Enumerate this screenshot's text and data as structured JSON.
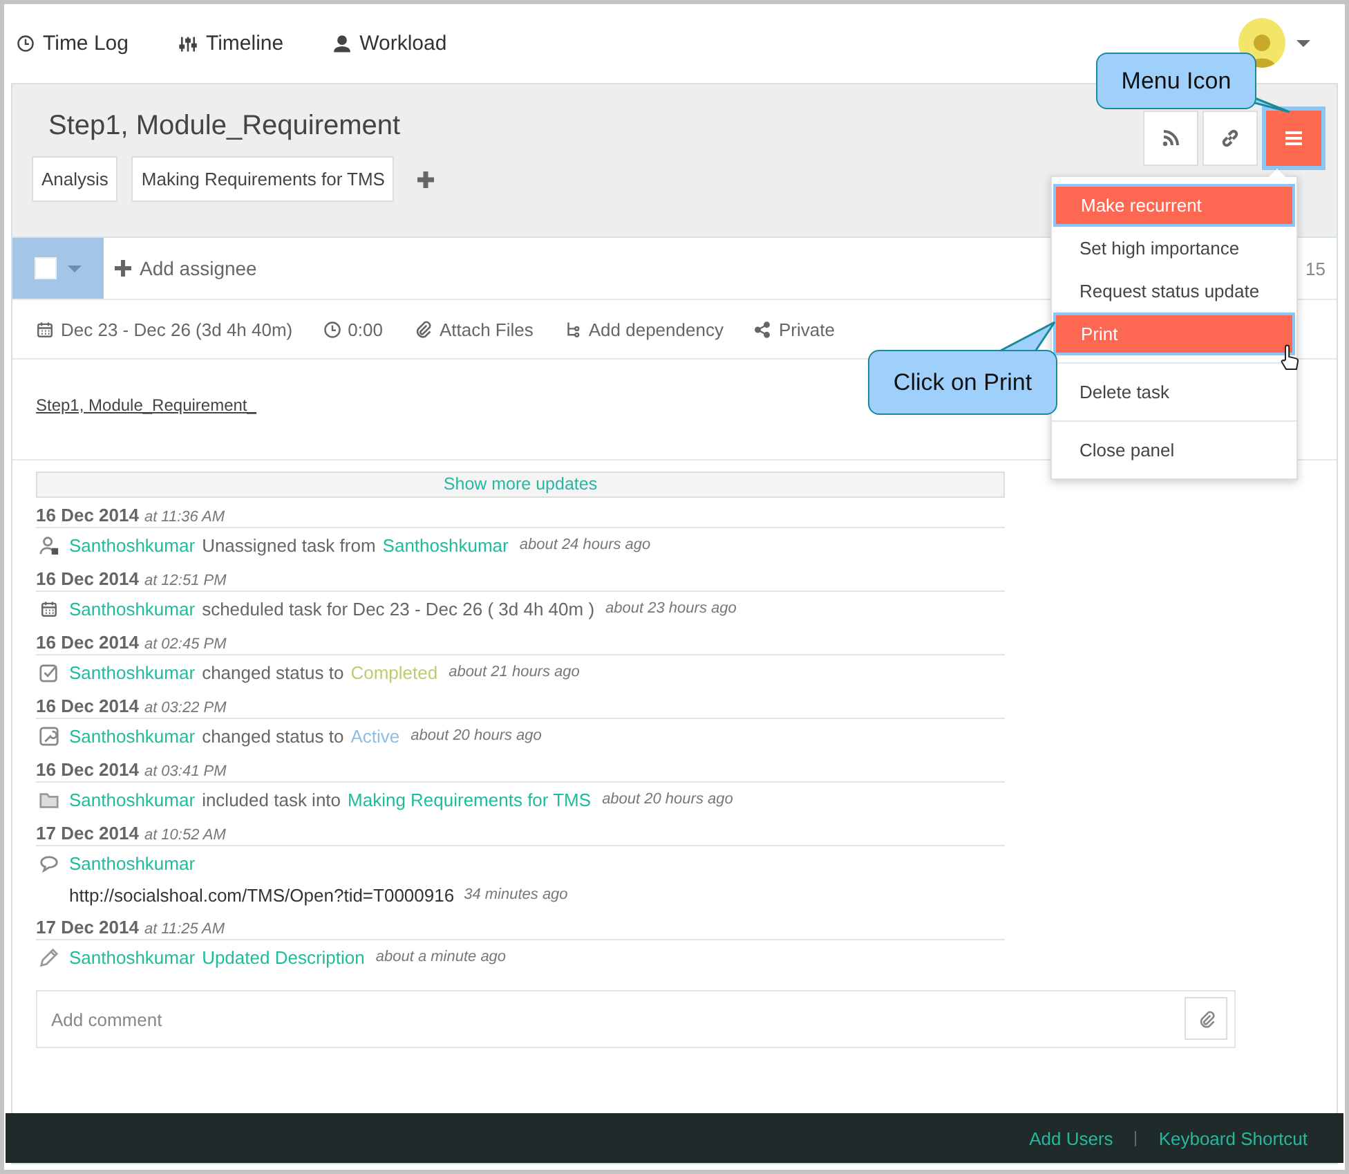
{
  "nav": [
    {
      "label": "Time Log"
    },
    {
      "label": "Timeline"
    },
    {
      "label": "Workload"
    }
  ],
  "task": {
    "title": "Step1, Module_Requirement",
    "tags": [
      "Analysis",
      "Making Requirements for TMS"
    ],
    "select_checkbox": {
      "checked": false
    },
    "add_assignee": "Add assignee",
    "assignee_count": "15",
    "meta": [
      {
        "label": "Dec 23 - Dec 26 (3d 4h 40m)"
      },
      {
        "label": "0:00"
      },
      {
        "label": "Attach Files"
      },
      {
        "label": "Add dependency"
      },
      {
        "label": "Private"
      }
    ],
    "description": "Step1, Module_Requirement_"
  },
  "menu": [
    {
      "label": "Make recurrent",
      "highlighted": true,
      "divider_before": false
    },
    {
      "label": "Set high importance",
      "highlighted": false,
      "divider_before": false
    },
    {
      "label": "Request status update",
      "highlighted": false,
      "divider_before": false
    },
    {
      "label": "Print",
      "highlighted": true,
      "divider_before": false
    },
    {
      "label": "Delete task",
      "highlighted": false,
      "divider_before": true
    },
    {
      "label": "Close panel",
      "highlighted": false,
      "divider_before": true
    }
  ],
  "callouts": [
    {
      "kind": "menu",
      "text": "Menu Icon"
    },
    {
      "kind": "print",
      "text": "Click on Print"
    }
  ],
  "updates": {
    "show_more": "Show more updates",
    "entries": [
      {
        "date": "16 Dec 2014",
        "time": "at 11:36 AM",
        "kind": "unassign",
        "segments": [
          {
            "kind": "user",
            "text": "Santhoshkumar"
          },
          {
            "kind": "text",
            "text": "Unassigned task from"
          },
          {
            "kind": "user",
            "text": "Santhoshkumar"
          }
        ],
        "ago": "about 24 hours ago"
      },
      {
        "date": "16 Dec 2014",
        "time": "at 12:51 PM",
        "kind": "calendar",
        "segments": [
          {
            "kind": "user",
            "text": "Santhoshkumar"
          },
          {
            "kind": "text",
            "text": "scheduled task for Dec 23 - Dec 26 ( 3d 4h 40m )"
          }
        ],
        "ago": "about 23 hours ago"
      },
      {
        "date": "16 Dec 2014",
        "time": "at 02:45 PM",
        "kind": "check",
        "segments": [
          {
            "kind": "user",
            "text": "Santhoshkumar"
          },
          {
            "kind": "text",
            "text": "changed status to"
          },
          {
            "kind": "status",
            "text": "Completed",
            "color": "#b9cf6d"
          }
        ],
        "ago": "about 21 hours ago"
      },
      {
        "date": "16 Dec 2014",
        "time": "at 03:22 PM",
        "kind": "wrench",
        "segments": [
          {
            "kind": "user",
            "text": "Santhoshkumar"
          },
          {
            "kind": "text",
            "text": "changed status to"
          },
          {
            "kind": "status",
            "text": "Active",
            "color": "#8fbde3"
          }
        ],
        "ago": "about 20 hours ago"
      },
      {
        "date": "16 Dec 2014",
        "time": "at 03:41 PM",
        "kind": "folder",
        "segments": [
          {
            "kind": "user",
            "text": "Santhoshkumar"
          },
          {
            "kind": "text",
            "text": "included task into"
          },
          {
            "kind": "link",
            "text": "Making Requirements for TMS"
          }
        ],
        "ago": "about 20 hours ago"
      },
      {
        "date": "17 Dec 2014",
        "time": "at 10:52 AM",
        "kind": "comment",
        "segments": [
          {
            "kind": "user",
            "text": "Santhoshkumar"
          }
        ],
        "body": "http://socialshoal.com/TMS/Open?tid=T0000916",
        "ago": "34 minutes ago"
      },
      {
        "date": "17 Dec 2014",
        "time": "at 11:25 AM",
        "kind": "pencil",
        "segments": [
          {
            "kind": "user",
            "text": "Santhoshkumar"
          },
          {
            "kind": "link",
            "text": "Updated Description"
          }
        ],
        "ago": "about a minute ago"
      }
    ]
  },
  "comment": {
    "placeholder": "Add comment"
  },
  "footer": [
    "Add Users",
    "Keyboard Shortcut"
  ]
}
